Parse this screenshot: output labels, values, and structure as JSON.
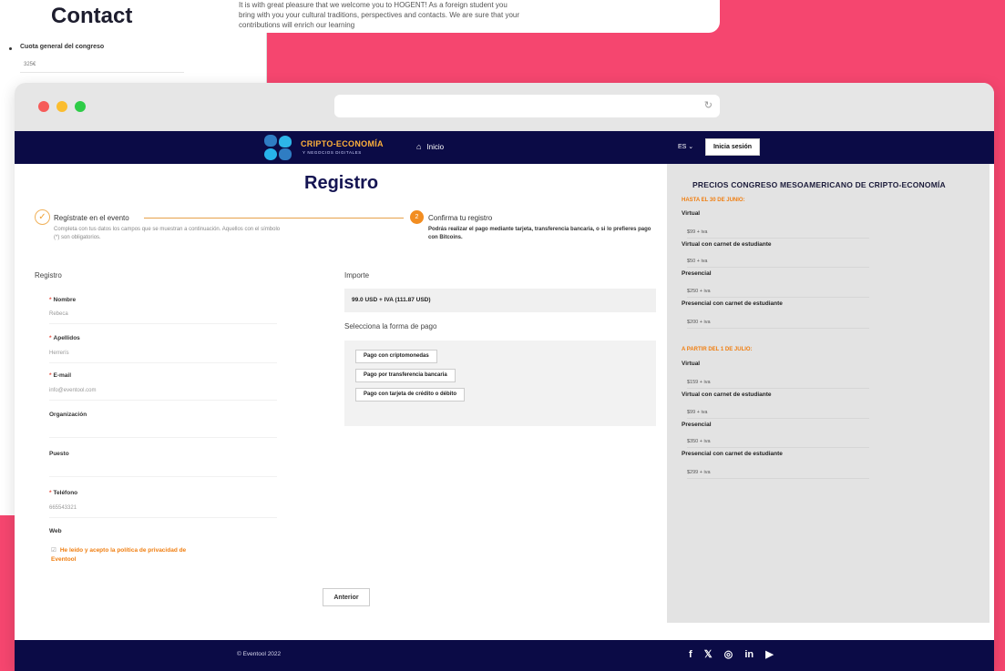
{
  "background": {
    "contact_title": "Contact",
    "paragraph": "It is with great pleasure that we welcome you to HOGENT! As a foreign student you bring with you your cultural traditions, perspectives and contacts. We are sure that your contributions will enrich our learning",
    "fee_label": "Cuota general del congreso",
    "fee_value": "325€"
  },
  "browser": {
    "url": "",
    "reload_icon": "reload-icon"
  },
  "nav": {
    "brand": "CRIPTO-ECONOMÍA",
    "brand_sub": "Y NEGOCIOS DIGITALES",
    "home": "Inicio",
    "language": "ES",
    "login": "Inicia sesión"
  },
  "page": {
    "title": "Registro"
  },
  "steps": [
    {
      "title": "Regístrate en el evento",
      "description": "Completa con tus datos los campos que se muestran a continuación. Aquellos con el símbolo (*) son obligatorios.",
      "icon": "check"
    },
    {
      "number": "2",
      "title": "Confirma tu registro",
      "description": "Podrás realizar el pago mediante tarjeta, transferencia bancaria, o si lo prefieres pago con Bitcoins."
    }
  ],
  "form": {
    "heading": "Registro",
    "fields": [
      {
        "label": "Nombre",
        "value": "Rebeca",
        "required": true
      },
      {
        "label": "Apellidos",
        "value": "Herrerís",
        "required": true
      },
      {
        "label": "E-mail",
        "value": "info@eventool.com",
        "required": true
      },
      {
        "label": "Organización",
        "value": "",
        "required": false
      },
      {
        "label": "Puesto",
        "value": "",
        "required": false
      },
      {
        "label": "Teléfono",
        "value": "665543321",
        "required": true
      },
      {
        "label": "Web",
        "value": "",
        "required": false
      }
    ],
    "privacy": "He leído y acepto la política de privacidad de Eventool",
    "prev_button": "Anterior"
  },
  "payment": {
    "importe_heading": "Importe",
    "amount": "99.0 USD + IVA (111.87 USD)",
    "method_heading": "Selecciona la forma de pago",
    "methods": [
      "Pago con criptomonedas",
      "Pago por transferencia bancaria",
      "Pago con tarjeta de crédito o débito"
    ]
  },
  "prices": {
    "title": "PRECIOS CONGRESO MESOAMERICANO DE CRIPTO-ECONOMÍA",
    "sections": [
      {
        "heading": "HASTA EL 30 DE JUNIO:",
        "items": [
          {
            "label": "Virtual",
            "value": "$99 + iva"
          },
          {
            "label": "Virtual con carnet de estudiante",
            "value": "$50 + iva"
          },
          {
            "label": "Presencial",
            "value": "$250 + iva"
          },
          {
            "label": "Presencial con carnet de estudiante",
            "value": "$200 + iva"
          }
        ]
      },
      {
        "heading": "A PARTIR DEL 1 DE JULIO:",
        "items": [
          {
            "label": "Virtual",
            "value": "$159 + iva"
          },
          {
            "label": "Virtual con carnet de estudiante",
            "value": "$99 + iva"
          },
          {
            "label": "Presencial",
            "value": "$350 + iva"
          },
          {
            "label": "Presencial con carnet de estudiante",
            "value": "$299 + iva"
          }
        ]
      }
    ]
  },
  "footer": {
    "copyright": "© Eventool 2022",
    "social": [
      "f",
      "𝕏",
      "◎",
      "in",
      "▶"
    ]
  },
  "colors": {
    "background": "#f5466f",
    "navy": "#0b0b46",
    "accent": "#f28d21"
  }
}
